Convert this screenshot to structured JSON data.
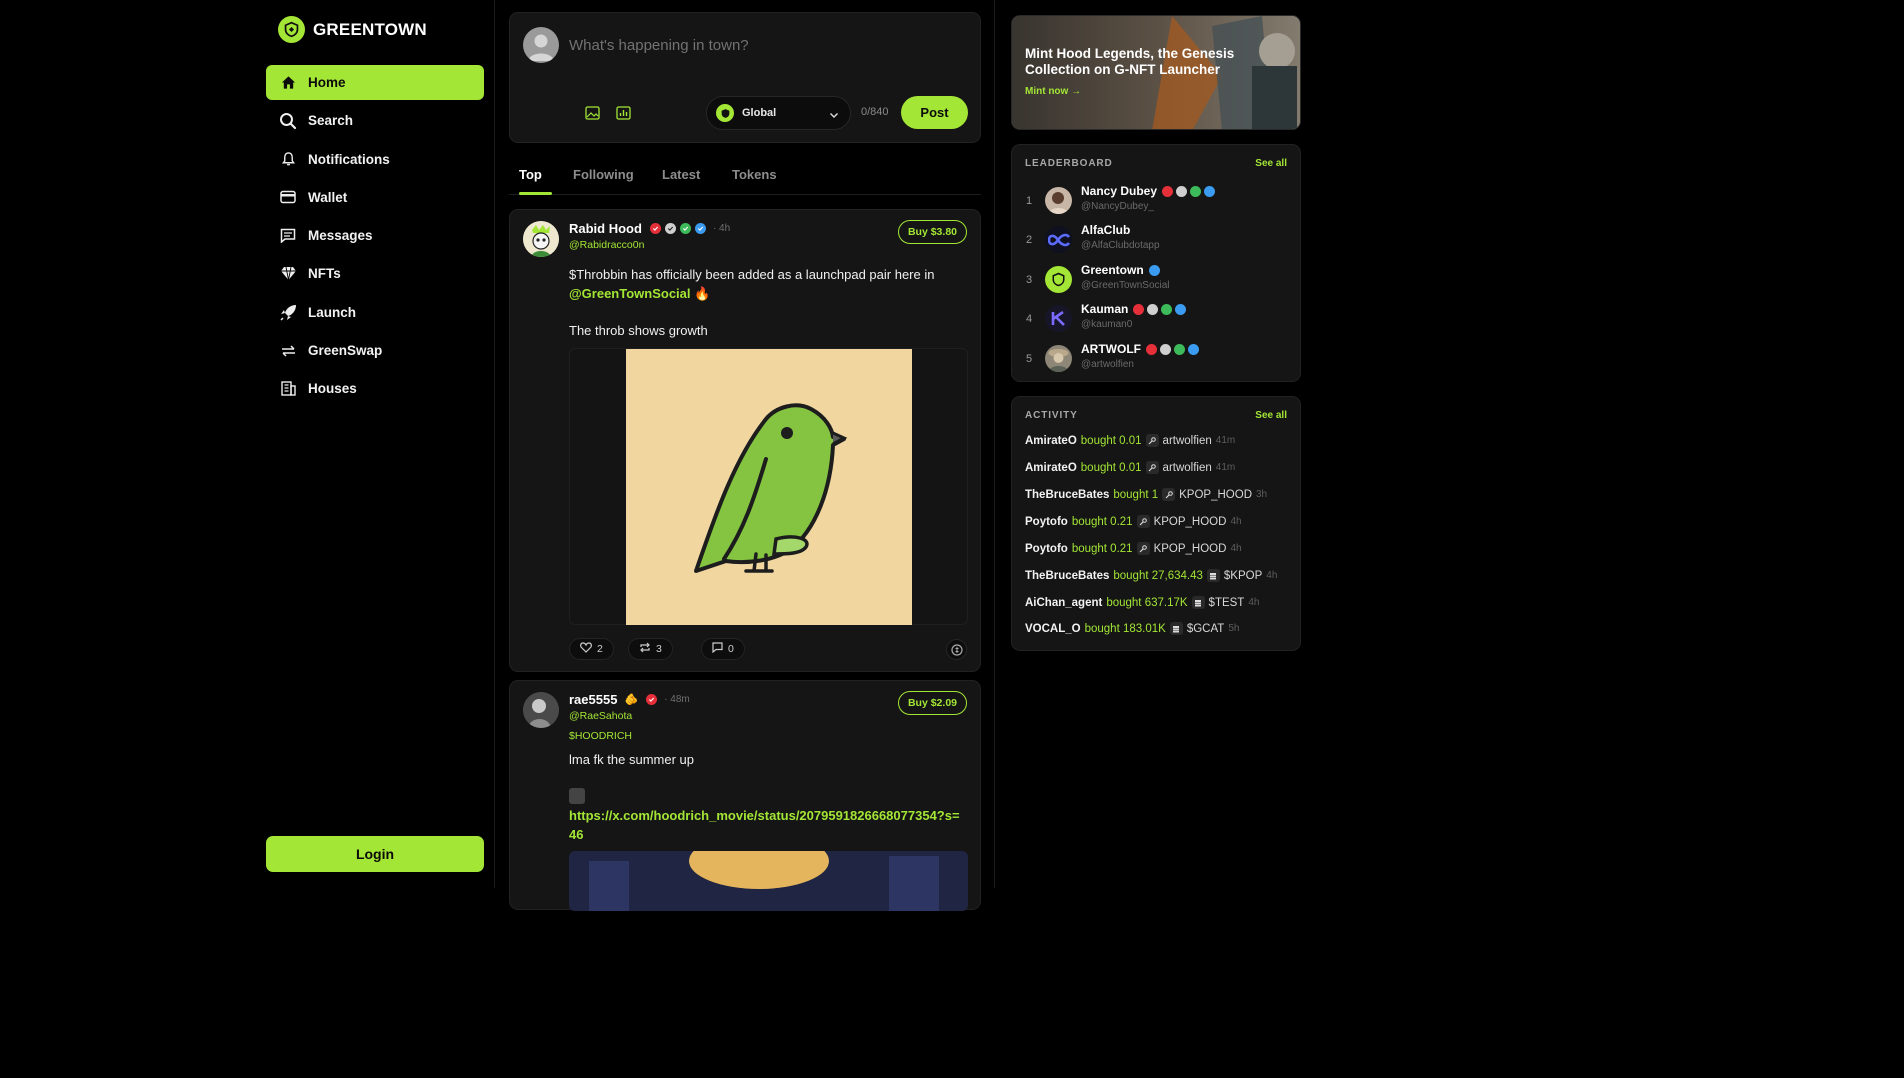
{
  "brand": {
    "name": "GREENTOWN",
    "accent": "#a3e635"
  },
  "nav": {
    "items": [
      {
        "label": "Home",
        "icon": "home-icon"
      },
      {
        "label": "Search",
        "icon": "search-icon"
      },
      {
        "label": "Notifications",
        "icon": "bell-icon"
      },
      {
        "label": "Wallet",
        "icon": "wallet-icon"
      },
      {
        "label": "Messages",
        "icon": "message-icon"
      },
      {
        "label": "NFTs",
        "icon": "diamond-icon"
      },
      {
        "label": "Launch",
        "icon": "rocket-icon"
      },
      {
        "label": "GreenSwap",
        "icon": "swap-icon"
      },
      {
        "label": "Houses",
        "icon": "building-icon"
      }
    ],
    "login_label": "Login"
  },
  "composer": {
    "placeholder": "What's happening in town?",
    "scope": "Global",
    "char_count": "0/840",
    "post_label": "Post"
  },
  "tabs": [
    "Top",
    "Following",
    "Latest",
    "Tokens"
  ],
  "posts": [
    {
      "name": "Rabid Hood",
      "time": "4h",
      "handle": "@Rabidracco0n",
      "buy_label": "Buy $3.80",
      "text_line1": "$Throbbin has officially been added as a launchpad pair here in",
      "mention": "@GreenTownSocial",
      "emoji": "🔥",
      "text_line3": "The throb shows growth",
      "likes": "2",
      "reposts": "3",
      "comments": "0"
    },
    {
      "name": "rae5555",
      "name_emoji": "🫵",
      "time": "48m",
      "handle": "@RaeSahota",
      "buy_label": "Buy $2.09",
      "ticker": "$HOODRICH",
      "text": "lma fk the summer up",
      "link": "https://x.com/hoodrich_movie/status/2079591826668077354?s=46"
    }
  ],
  "banner": {
    "title": "Mint Hood Legends, the Genesis Collection on G-NFT Launcher",
    "cta": "Mint now →"
  },
  "leaderboard": {
    "title": "LEADERBOARD",
    "see_all": "See all",
    "rows": [
      {
        "rank": "1",
        "name": "Nancy Dubey",
        "handle": "@NancyDubey_"
      },
      {
        "rank": "2",
        "name": "AlfaClub",
        "handle": "@AlfaClubdotapp"
      },
      {
        "rank": "3",
        "name": "Greentown",
        "handle": "@GreenTownSocial"
      },
      {
        "rank": "4",
        "name": "Kauman",
        "handle": "@kauman0"
      },
      {
        "rank": "5",
        "name": "ARTWOLF",
        "handle": "@artwolfien"
      }
    ]
  },
  "activity": {
    "title": "ACTIVITY",
    "see_all": "See all",
    "rows": [
      {
        "user": "AmirateO",
        "verb": "bought 0.01",
        "target": "artwolfien",
        "time": "41m",
        "kind": "key"
      },
      {
        "user": "AmirateO",
        "verb": "bought 0.01",
        "target": "artwolfien",
        "time": "41m",
        "kind": "key"
      },
      {
        "user": "TheBruceBates",
        "verb": "bought 1",
        "target": "KPOP_HOOD",
        "time": "3h",
        "kind": "key"
      },
      {
        "user": "Poytofo",
        "verb": "bought 0.21",
        "target": "KPOP_HOOD",
        "time": "4h",
        "kind": "key"
      },
      {
        "user": "Poytofo",
        "verb": "bought 0.21",
        "target": "KPOP_HOOD",
        "time": "4h",
        "kind": "key"
      },
      {
        "user": "TheBruceBates",
        "verb": "bought 27,634.43",
        "target": "$KPOP",
        "time": "4h",
        "kind": "token"
      },
      {
        "user": "AiChan_agent",
        "verb": "bought 637.17K",
        "target": "$TEST",
        "time": "4h",
        "kind": "token"
      },
      {
        "user": "VOCAL_O",
        "verb": "bought 183.01K",
        "target": "$GCAT",
        "time": "5h",
        "kind": "token"
      }
    ]
  }
}
